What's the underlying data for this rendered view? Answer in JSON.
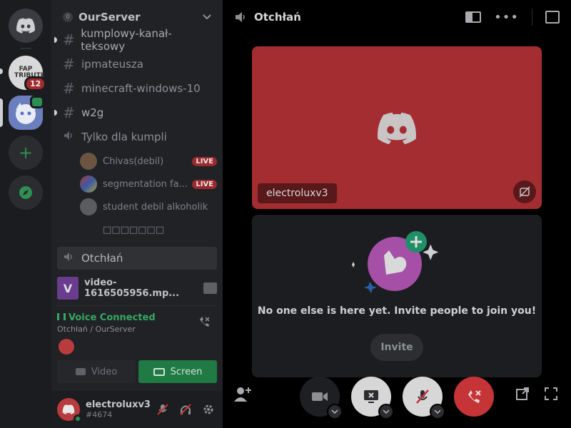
{
  "server": {
    "name": "OurServer",
    "boost_level": "0"
  },
  "rail": {
    "fap_tribute_label": "FAP TRIBUTE",
    "fap_tribute_badge": "12"
  },
  "channels": [
    {
      "type": "text",
      "name": "kumplowy-kanał-teksowy",
      "unread": true
    },
    {
      "type": "text",
      "name": "ipmateusza",
      "unread": false
    },
    {
      "type": "text",
      "name": "minecraft-windows-10",
      "unread": false
    },
    {
      "type": "text",
      "name": "w2g",
      "unread": true
    },
    {
      "type": "voice",
      "name": "Tylko dla kumpli"
    }
  ],
  "voice_users": [
    {
      "name": "Chivas(debil)",
      "live": "LIVE"
    },
    {
      "name": "segmentation fa...",
      "live": "LIVE"
    },
    {
      "name": "student debil alkoholik",
      "live": ""
    },
    {
      "name": "□□□□□□□",
      "live": ""
    }
  ],
  "active_voice_channel": "Otchłań",
  "stream": {
    "thumb_letter": "V",
    "title": "video-1616505956.mp..."
  },
  "voice_status": {
    "label": "Voice Connected",
    "location": "Otchłań / OurServer"
  },
  "panel_buttons": {
    "video": "Video",
    "screen": "Screen"
  },
  "user": {
    "name": "electroluxv3",
    "tag": "#4674"
  },
  "topbar": {
    "title": "Otchłań"
  },
  "stage": {
    "tile_name": "electroluxv3",
    "empty_message": "No one else is here yet. Invite people to join you!",
    "invite_label": "Invite"
  },
  "colors": {
    "accent_red": "#a32d31",
    "voice_green": "#36a861",
    "screen_green": "#1f7a44",
    "hangup_red": "#c53437"
  }
}
